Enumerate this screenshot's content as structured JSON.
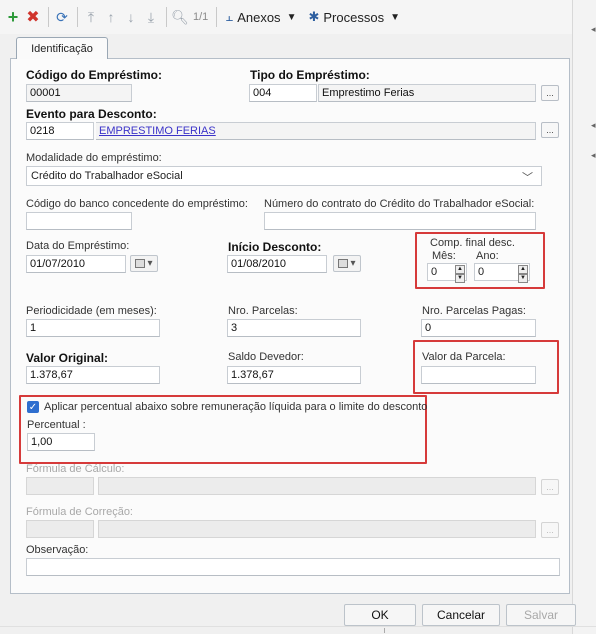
{
  "toolbar": {
    "page_indicator": "1/1",
    "anexos_label": "Anexos",
    "processos_label": "Processos"
  },
  "tabs": [
    {
      "label": "Identificação"
    }
  ],
  "form": {
    "codigo_emprestimo": {
      "label": "Código do Empréstimo:",
      "value": "00001"
    },
    "tipo_emprestimo": {
      "label": "Tipo do Empréstimo:",
      "code": "004",
      "description": "Emprestimo Ferias"
    },
    "evento_desconto": {
      "label": "Evento para Desconto:",
      "code": "0218",
      "description": "EMPRESTIMO FERIAS"
    },
    "modalidade": {
      "label": "Modalidade do empréstimo:",
      "value": "Crédito do Trabalhador eSocial"
    },
    "codigo_banco": {
      "label": "Código do banco concedente do empréstimo:",
      "value": ""
    },
    "numero_contrato": {
      "label": "Número do contrato do Crédito do Trabalhador eSocial:",
      "value": ""
    },
    "data_emprestimo": {
      "label": "Data do Empréstimo:",
      "value": "01/07/2010"
    },
    "inicio_desconto": {
      "label": "Início Desconto:",
      "value": "01/08/2010"
    },
    "comp_final": {
      "label": "Comp. final desc.",
      "mes_label": "Mês:",
      "mes_value": "0",
      "ano_label": "Ano:",
      "ano_value": "0"
    },
    "periodicidade": {
      "label": "Periodicidade (em meses):",
      "value": "1"
    },
    "nro_parcelas": {
      "label": "Nro. Parcelas:",
      "value": "3"
    },
    "nro_parcelas_pagas": {
      "label": "Nro. Parcelas Pagas:",
      "value": "0"
    },
    "valor_original": {
      "label": "Valor Original:",
      "value": "1.378,67"
    },
    "saldo_devedor": {
      "label": "Saldo Devedor:",
      "value": "1.378,67"
    },
    "valor_parcela": {
      "label": "Valor da Parcela:",
      "value": ""
    },
    "aplicar_percentual": {
      "label": "Aplicar percentual abaixo sobre remuneração líquida para o limite do desconto",
      "checked": true
    },
    "percentual": {
      "label": "Percentual :",
      "value": "1,00"
    },
    "formula_calculo": {
      "label": "Fórmula de Cálculo:"
    },
    "formula_correcao": {
      "label": "Fórmula de Correção:"
    },
    "observacao": {
      "label": "Observação:",
      "value": ""
    }
  },
  "footer": {
    "ok_label": "OK",
    "cancel_label": "Cancelar",
    "save_label": "Salvar"
  },
  "colors": {
    "highlight": "#d63a3a",
    "link": "#3b33c9",
    "accent": "#2f6fcf"
  }
}
